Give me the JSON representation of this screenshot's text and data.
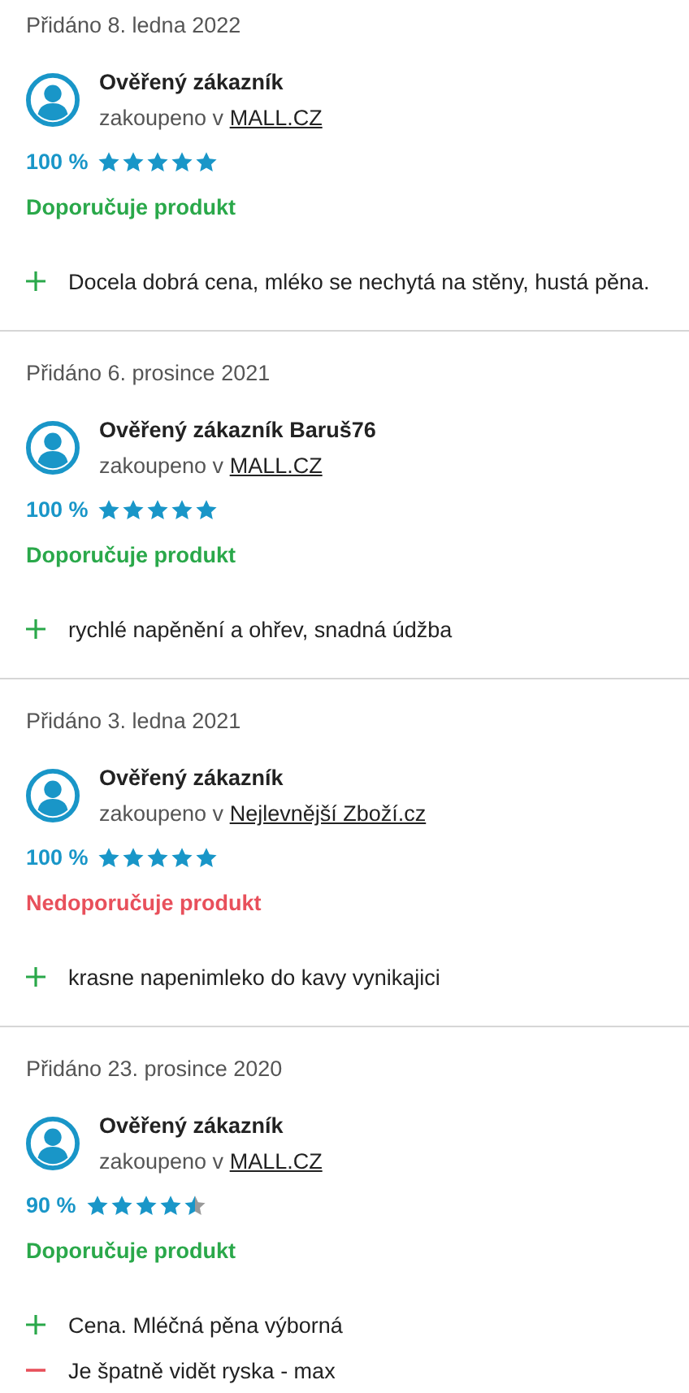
{
  "reviews": [
    {
      "date": "Přidáno 8. ledna 2022",
      "author": "Ověřený zákazník",
      "bought_prefix": "zakoupeno v",
      "shop": "MALL.CZ",
      "percent": "100 %",
      "stars": 5,
      "recommends": true,
      "verdict": "Doporučuje produkt",
      "points": [
        {
          "kind": "pro",
          "text": "Docela dobrá cena, mléko se nechytá na stěny, hustá pěna."
        }
      ]
    },
    {
      "date": "Přidáno 6. prosince 2021",
      "author": "Ověřený zákazník Baruš76",
      "bought_prefix": "zakoupeno v",
      "shop": "MALL.CZ",
      "percent": "100 %",
      "stars": 5,
      "recommends": true,
      "verdict": "Doporučuje produkt",
      "points": [
        {
          "kind": "pro",
          "text": "rychlé napěnění a ohřev, snadná údžba"
        }
      ]
    },
    {
      "date": "Přidáno 3. ledna 2021",
      "author": "Ověřený zákazník",
      "bought_prefix": "zakoupeno v",
      "shop": "Nejlevnější Zboží.cz",
      "percent": "100 %",
      "stars": 5,
      "recommends": false,
      "verdict": "Nedoporučuje produkt",
      "points": [
        {
          "kind": "pro",
          "text": "krasne napenimleko do kavy vynikajici"
        }
      ]
    },
    {
      "date": "Přidáno 23. prosince 2020",
      "author": "Ověřený zákazník",
      "bought_prefix": "zakoupeno v",
      "shop": "MALL.CZ",
      "percent": "90 %",
      "stars": 4.5,
      "recommends": true,
      "verdict": "Doporučuje produkt",
      "points": [
        {
          "kind": "pro",
          "text": "Cena. Mléčná pěna výborná"
        },
        {
          "kind": "con",
          "text": "Je špatně vidět ryska - max"
        }
      ]
    }
  ]
}
